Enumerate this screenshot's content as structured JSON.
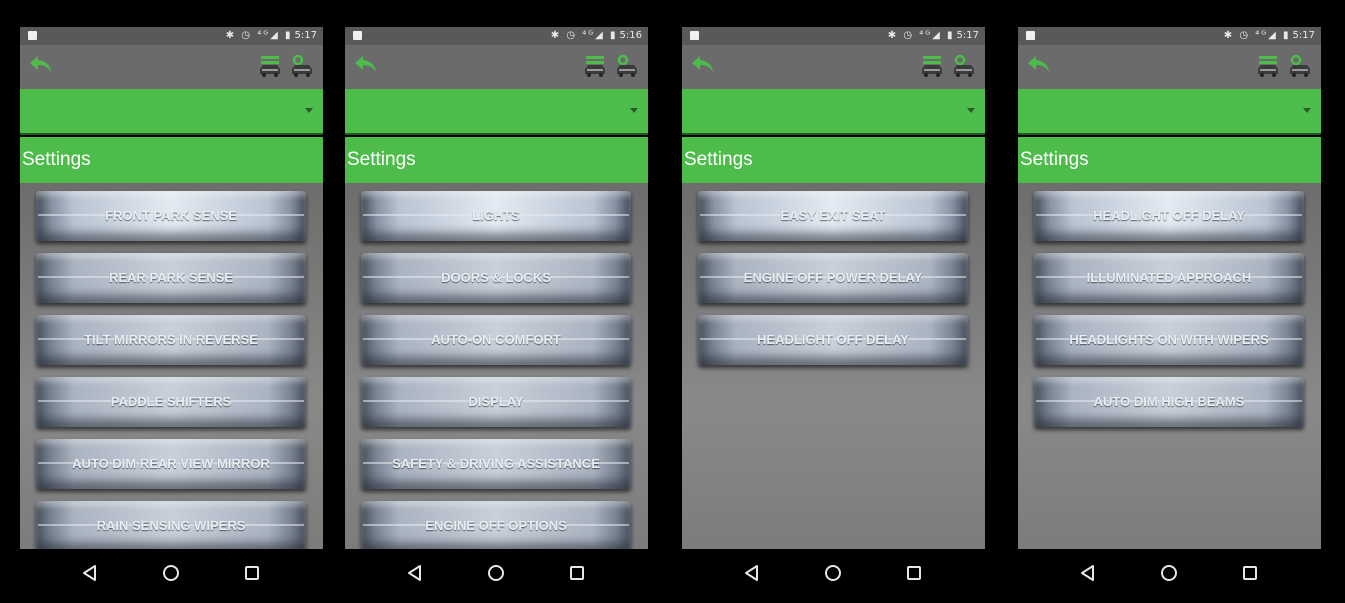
{
  "colors": {
    "accent_green": "#4dbc4a",
    "app_bar": "#6b6b6b",
    "status_bar": "#595959",
    "content_gray": "#7c7c7c",
    "icon_green": "#4dbc4a"
  },
  "screens": [
    {
      "status": {
        "time": "5:17",
        "icons": "✱ ◷ ⁴ᴳ◢ ▮"
      },
      "header": {
        "title": "Settings"
      },
      "dropdown": {
        "value": ""
      },
      "menu": [
        "FRONT PARK SENSE",
        "REAR PARK SENSE",
        "TILT MIRRORS IN REVERSE",
        "PADDLE SHIFTERS",
        "AUTO DIM REAR VIEW MIRROR",
        "RAIN SENSING WIPERS"
      ],
      "active_index": 0
    },
    {
      "status": {
        "time": "5:16",
        "icons": "✱ ◷ ⁴ᴳ◢ ▮"
      },
      "header": {
        "title": "Settings"
      },
      "dropdown": {
        "value": ""
      },
      "menu": [
        "LIGHTS",
        "DOORS & LOCKS",
        "AUTO-ON COMFORT",
        "DISPLAY",
        "SAFETY & DRIVING ASSISTANCE",
        "ENGINE OFF OPTIONS"
      ],
      "active_index": 0
    },
    {
      "status": {
        "time": "5:17",
        "icons": "✱ ◷ ⁴ᴳ◢ ▮"
      },
      "header": {
        "title": "Settings"
      },
      "dropdown": {
        "value": ""
      },
      "menu": [
        "EASY EXIT SEAT",
        "ENGINE OFF POWER DELAY",
        "HEADLIGHT OFF DELAY"
      ],
      "active_index": 0
    },
    {
      "status": {
        "time": "5:17",
        "icons": "✱ ◷ ⁴ᴳ◢ ▮"
      },
      "header": {
        "title": "Settings"
      },
      "dropdown": {
        "value": ""
      },
      "menu": [
        "HEADLIGHT OFF DELAY",
        "ILLUMINATED APPROACH",
        "HEADLIGHTS ON WITH WIPERS",
        "AUTO DIM HIGH BEAMS"
      ],
      "active_index": 0
    }
  ]
}
